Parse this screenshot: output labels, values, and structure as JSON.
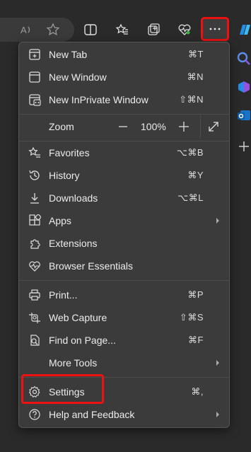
{
  "toolbar": {
    "icons": [
      "read-aloud-icon",
      "favorite-star-icon",
      "split-screen-icon",
      "favorites-icon",
      "collections-icon",
      "browser-essentials-icon",
      "more-icon",
      "copilot-icon"
    ],
    "read_aloud_label": "A"
  },
  "menu": {
    "items": [
      {
        "label": "New Tab",
        "shortcut": "⌘T",
        "icon": "new-tab-icon"
      },
      {
        "label": "New Window",
        "shortcut": "⌘N",
        "icon": "new-window-icon"
      },
      {
        "label": "New InPrivate Window",
        "shortcut": "⇧⌘N",
        "icon": "inprivate-window-icon"
      },
      {
        "label": "Zoom",
        "icon": "none"
      },
      {
        "label": "Favorites",
        "shortcut": "⌥⌘B",
        "icon": "favorites-icon"
      },
      {
        "label": "History",
        "shortcut": "⌘Y",
        "icon": "history-icon"
      },
      {
        "label": "Downloads",
        "shortcut": "⌥⌘L",
        "icon": "downloads-icon"
      },
      {
        "label": "Apps",
        "icon": "apps-icon",
        "submenu": true
      },
      {
        "label": "Extensions",
        "icon": "extensions-icon"
      },
      {
        "label": "Browser Essentials",
        "icon": "browser-essentials-icon"
      },
      {
        "label": "Print...",
        "shortcut": "⌘P",
        "icon": "print-icon"
      },
      {
        "label": "Web Capture",
        "shortcut": "⇧⌘S",
        "icon": "web-capture-icon"
      },
      {
        "label": "Find on Page...",
        "shortcut": "⌘F",
        "icon": "find-icon"
      },
      {
        "label": "More Tools",
        "icon": "none",
        "submenu": true
      },
      {
        "label": "Settings",
        "shortcut": "⌘,",
        "icon": "settings-icon"
      },
      {
        "label": "Help and Feedback",
        "icon": "help-icon",
        "submenu": true
      }
    ],
    "zoom_value": "100%"
  },
  "colors": {
    "highlight": "#ee1111",
    "menu_bg": "#3b3b3b"
  }
}
